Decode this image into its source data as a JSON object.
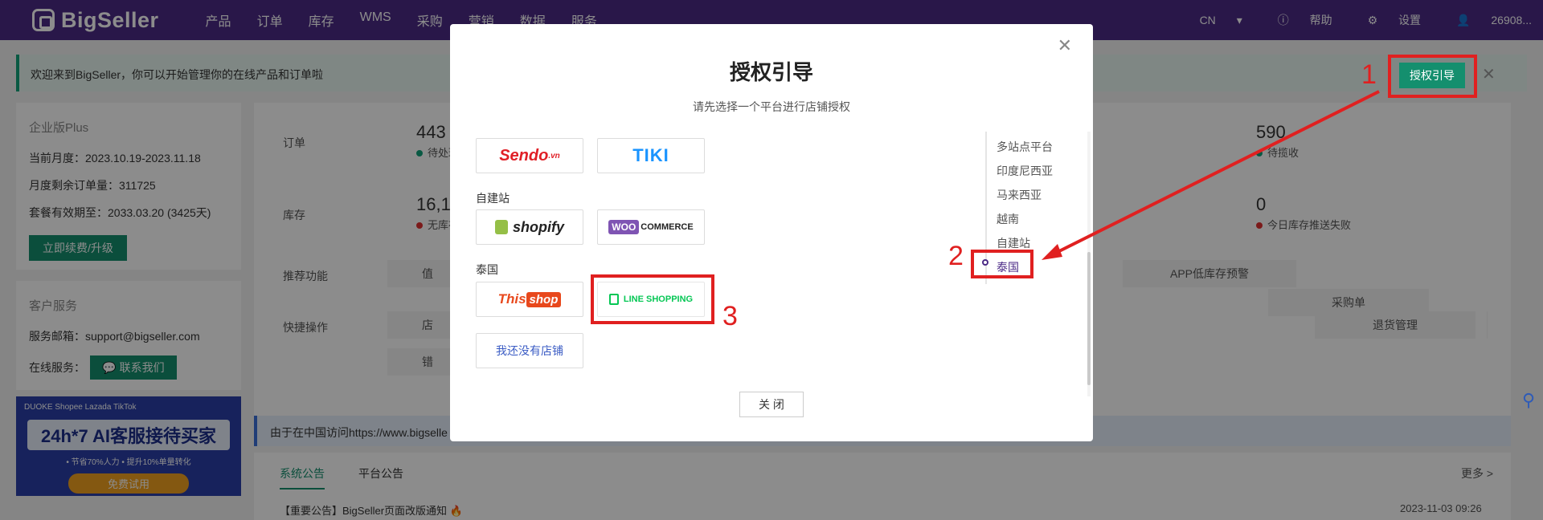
{
  "header": {
    "logo": "BigSeller",
    "nav": [
      "产品",
      "订单",
      "库存",
      "WMS",
      "采购",
      "营销",
      "数据",
      "服务"
    ],
    "lang": "CN",
    "help": "帮助",
    "settings": "设置",
    "user": "26908..."
  },
  "welcome": {
    "text": "欢迎来到BigSeller，你可以开始管理你的在线产品和订单啦",
    "auth_button": "授权引导"
  },
  "plan": {
    "title": "企业版Plus",
    "month_label": "当前月度：",
    "month_value": "2023.10.19-2023.11.18",
    "orders_label": "月度剩余订单量：",
    "orders_value": "311725",
    "expire_label": "套餐有效期至：",
    "expire_value": "2033.03.20 (3425天)",
    "renew_button": "立即续费/升级"
  },
  "support": {
    "title": "客户服务",
    "email_label": "服务邮箱：",
    "email_value": "support@bigseller.com",
    "online_label": "在线服务：",
    "contact_button": "联系我们"
  },
  "banner": {
    "brands": "DUOKE  Shopee  Lazada  TikTok",
    "headline": "24h*7 AI客服接待买家",
    "sub": "• 节省70%人力  • 提升10%单量转化",
    "cta": "免费试用"
  },
  "dashboard": {
    "order_label": "订单",
    "order_count": "443",
    "order_status": "待处理",
    "order_right_count": "590",
    "order_right_status": "待揽收",
    "stock_label": "库存",
    "stock_count": "16,1",
    "stock_status": "无库存",
    "stock_right_count": "0",
    "stock_right_status": "今日库存推送失败",
    "recommend_label": "推荐功能",
    "recommend_first": "值",
    "recommend_app": "APP低库存预警",
    "quick_label": "快捷操作",
    "quick_first": "店",
    "quick_returns": "退货管理",
    "quick_purchase": "采购单",
    "quick_extra": "错"
  },
  "notice": "由于在中国访问https://www.bigselle",
  "announcements": {
    "tab_system": "系统公告",
    "tab_platform": "平台公告",
    "more": "更多 >",
    "item_title": "【重要公告】BigSeller页面改版通知",
    "item_date": "2023-11-03 09:26"
  },
  "modal": {
    "title": "授权引导",
    "subtitle": "请先选择一个平台进行店铺授权",
    "group_selfsite": "自建站",
    "group_thailand": "泰国",
    "platforms": {
      "sendo": "Sendo",
      "sendo_suffix": ".vn",
      "tiki": "TIKI",
      "shopify": "shopify",
      "woo_mark": "WOO",
      "woo_text": "COMMERCE",
      "thisshop_this": "This",
      "thisshop_shop": "shop",
      "line": "LINE SHOPPING"
    },
    "no_store": "我还没有店铺",
    "anchors": [
      "多站点平台",
      "印度尼西亚",
      "马来西亚",
      "越南",
      "自建站",
      "泰国"
    ],
    "close_button": "关 闭"
  },
  "annotations": [
    "1",
    "2",
    "3"
  ],
  "colors": {
    "header": "#4b2a86",
    "brand_green": "#148f6e",
    "annotation_red": "#e02020",
    "line_green": "#06c755"
  }
}
